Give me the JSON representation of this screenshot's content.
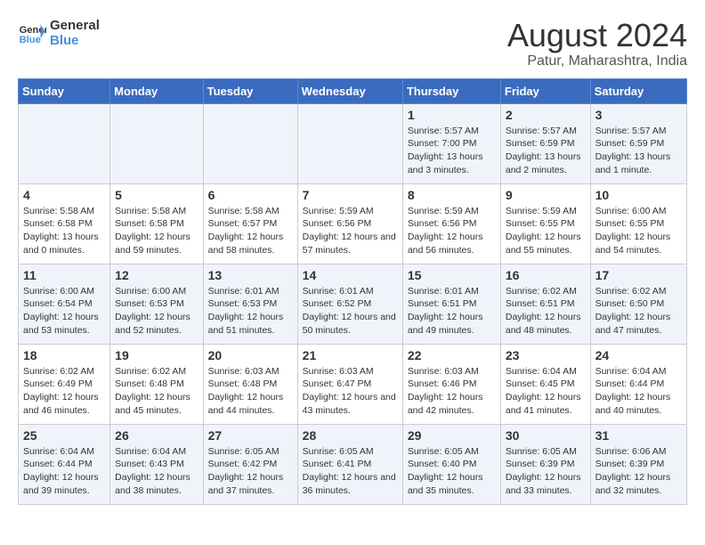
{
  "logo": {
    "text_general": "General",
    "text_blue": "Blue"
  },
  "header": {
    "title": "August 2024",
    "subtitle": "Patur, Maharashtra, India"
  },
  "weekdays": [
    "Sunday",
    "Monday",
    "Tuesday",
    "Wednesday",
    "Thursday",
    "Friday",
    "Saturday"
  ],
  "weeks": [
    [
      {
        "day": "",
        "info": ""
      },
      {
        "day": "",
        "info": ""
      },
      {
        "day": "",
        "info": ""
      },
      {
        "day": "",
        "info": ""
      },
      {
        "day": "1",
        "info": "Sunrise: 5:57 AM\nSunset: 7:00 PM\nDaylight: 13 hours and 3 minutes."
      },
      {
        "day": "2",
        "info": "Sunrise: 5:57 AM\nSunset: 6:59 PM\nDaylight: 13 hours and 2 minutes."
      },
      {
        "day": "3",
        "info": "Sunrise: 5:57 AM\nSunset: 6:59 PM\nDaylight: 13 hours and 1 minute."
      }
    ],
    [
      {
        "day": "4",
        "info": "Sunrise: 5:58 AM\nSunset: 6:58 PM\nDaylight: 13 hours and 0 minutes."
      },
      {
        "day": "5",
        "info": "Sunrise: 5:58 AM\nSunset: 6:58 PM\nDaylight: 12 hours and 59 minutes."
      },
      {
        "day": "6",
        "info": "Sunrise: 5:58 AM\nSunset: 6:57 PM\nDaylight: 12 hours and 58 minutes."
      },
      {
        "day": "7",
        "info": "Sunrise: 5:59 AM\nSunset: 6:56 PM\nDaylight: 12 hours and 57 minutes."
      },
      {
        "day": "8",
        "info": "Sunrise: 5:59 AM\nSunset: 6:56 PM\nDaylight: 12 hours and 56 minutes."
      },
      {
        "day": "9",
        "info": "Sunrise: 5:59 AM\nSunset: 6:55 PM\nDaylight: 12 hours and 55 minutes."
      },
      {
        "day": "10",
        "info": "Sunrise: 6:00 AM\nSunset: 6:55 PM\nDaylight: 12 hours and 54 minutes."
      }
    ],
    [
      {
        "day": "11",
        "info": "Sunrise: 6:00 AM\nSunset: 6:54 PM\nDaylight: 12 hours and 53 minutes."
      },
      {
        "day": "12",
        "info": "Sunrise: 6:00 AM\nSunset: 6:53 PM\nDaylight: 12 hours and 52 minutes."
      },
      {
        "day": "13",
        "info": "Sunrise: 6:01 AM\nSunset: 6:53 PM\nDaylight: 12 hours and 51 minutes."
      },
      {
        "day": "14",
        "info": "Sunrise: 6:01 AM\nSunset: 6:52 PM\nDaylight: 12 hours and 50 minutes."
      },
      {
        "day": "15",
        "info": "Sunrise: 6:01 AM\nSunset: 6:51 PM\nDaylight: 12 hours and 49 minutes."
      },
      {
        "day": "16",
        "info": "Sunrise: 6:02 AM\nSunset: 6:51 PM\nDaylight: 12 hours and 48 minutes."
      },
      {
        "day": "17",
        "info": "Sunrise: 6:02 AM\nSunset: 6:50 PM\nDaylight: 12 hours and 47 minutes."
      }
    ],
    [
      {
        "day": "18",
        "info": "Sunrise: 6:02 AM\nSunset: 6:49 PM\nDaylight: 12 hours and 46 minutes."
      },
      {
        "day": "19",
        "info": "Sunrise: 6:02 AM\nSunset: 6:48 PM\nDaylight: 12 hours and 45 minutes."
      },
      {
        "day": "20",
        "info": "Sunrise: 6:03 AM\nSunset: 6:48 PM\nDaylight: 12 hours and 44 minutes."
      },
      {
        "day": "21",
        "info": "Sunrise: 6:03 AM\nSunset: 6:47 PM\nDaylight: 12 hours and 43 minutes."
      },
      {
        "day": "22",
        "info": "Sunrise: 6:03 AM\nSunset: 6:46 PM\nDaylight: 12 hours and 42 minutes."
      },
      {
        "day": "23",
        "info": "Sunrise: 6:04 AM\nSunset: 6:45 PM\nDaylight: 12 hours and 41 minutes."
      },
      {
        "day": "24",
        "info": "Sunrise: 6:04 AM\nSunset: 6:44 PM\nDaylight: 12 hours and 40 minutes."
      }
    ],
    [
      {
        "day": "25",
        "info": "Sunrise: 6:04 AM\nSunset: 6:44 PM\nDaylight: 12 hours and 39 minutes."
      },
      {
        "day": "26",
        "info": "Sunrise: 6:04 AM\nSunset: 6:43 PM\nDaylight: 12 hours and 38 minutes."
      },
      {
        "day": "27",
        "info": "Sunrise: 6:05 AM\nSunset: 6:42 PM\nDaylight: 12 hours and 37 minutes."
      },
      {
        "day": "28",
        "info": "Sunrise: 6:05 AM\nSunset: 6:41 PM\nDaylight: 12 hours and 36 minutes."
      },
      {
        "day": "29",
        "info": "Sunrise: 6:05 AM\nSunset: 6:40 PM\nDaylight: 12 hours and 35 minutes."
      },
      {
        "day": "30",
        "info": "Sunrise: 6:05 AM\nSunset: 6:39 PM\nDaylight: 12 hours and 33 minutes."
      },
      {
        "day": "31",
        "info": "Sunrise: 6:06 AM\nSunset: 6:39 PM\nDaylight: 12 hours and 32 minutes."
      }
    ]
  ]
}
